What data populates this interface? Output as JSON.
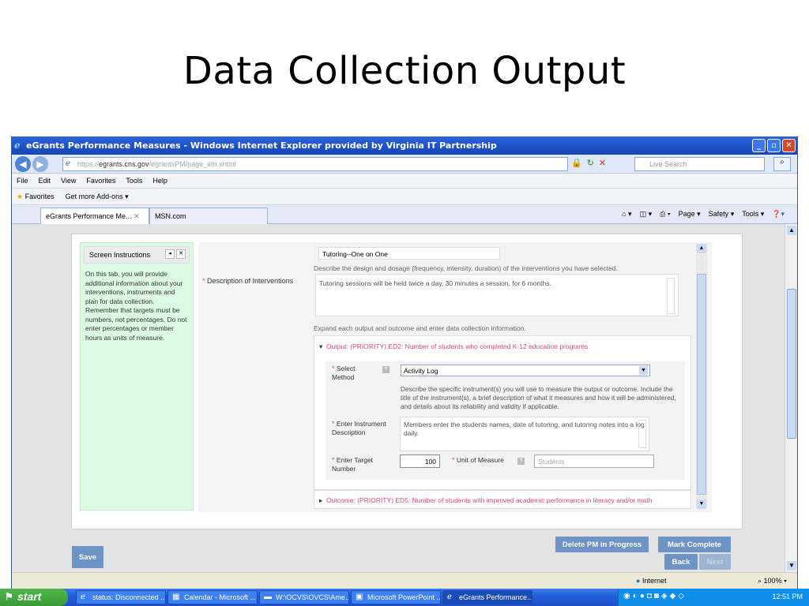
{
  "slide": {
    "title": "Data Collection Output"
  },
  "window": {
    "title": "eGrants Performance Measures - Windows Internet Explorer provided by Virginia IT Partnership"
  },
  "address": {
    "url_prefix": "https://",
    "url_host": "egrants.cns.gov",
    "url_path": "/egrantsPM/page_am.xhtml",
    "search_placeholder": "Live Search"
  },
  "menu": [
    "File",
    "Edit",
    "View",
    "Favorites",
    "Tools",
    "Help"
  ],
  "favorites": {
    "label": "Favorites",
    "addons": "Get more Add-ons"
  },
  "tabs": {
    "active": "eGrants Performance Me...",
    "other": "MSN.com"
  },
  "command_bar": [
    "Page",
    "Safety",
    "Tools"
  ],
  "sidebar": {
    "title": "Screen Instructions",
    "text": "On this tab, you will provide additional information about your interventions, instruments and plan for data collection. Remember that targets must be numbers, not percentages. Do not enter percentages or member hours as units of measure."
  },
  "form": {
    "intervention_name": "Tutoring--One on One",
    "describe_hint": "Describe the design and dosage (frequency, intensity, duration) of the interventions you have selected.",
    "description_label": "Description of Interventions",
    "description_value": "Tutoring sessions will be held twice a day, 30 minutes a session, for 6 months.",
    "expand_hint": "Expand each output and outcome and enter data collection information.",
    "output_title": "Output: (PRIORITY) ED2: Number of students who completed K-12 education programs",
    "select_method_label": "Select Method",
    "select_method_value": "Activity Log",
    "instrument_hint": "Describe the specific instrument(s) you will use to measure the output or outcome. Include the title of the instrument(s), a brief description of what it measures and how it will be administered, and details about its reliability and validity if applicable.",
    "instrument_label": "Enter Instrument Description",
    "instrument_value": "Members enter the students names, date of tutoring, and tutoring notes into a log daily.",
    "target_label": "Enter Target Number",
    "target_value": "100",
    "unit_label": "Unit of Measure",
    "unit_value": "Students",
    "outcome_title": "Outcome: (PRIORITY) ED5: Number of students with improved academic performance in literacy and/or math"
  },
  "buttons": {
    "save": "Save",
    "delete": "Delete PM in Progress",
    "complete": "Mark Complete",
    "back": "Back",
    "next": "Next"
  },
  "status": {
    "zone": "Internet",
    "zoom": "100%"
  },
  "taskbar": {
    "start": "start",
    "tasks": [
      "status: Disconnected ...",
      "Calendar - Microsoft ...",
      "W:\\OCVS\\OVCS\\Ame...",
      "Microsoft PowerPoint ...",
      "eGrants Performance..."
    ],
    "clock": "12:51 PM"
  },
  "colors": {
    "accent": "#e0457b",
    "button": "#6d94c4",
    "sidebar_bg": "#ddfbe2",
    "titlebar": "#1c4fc4"
  }
}
